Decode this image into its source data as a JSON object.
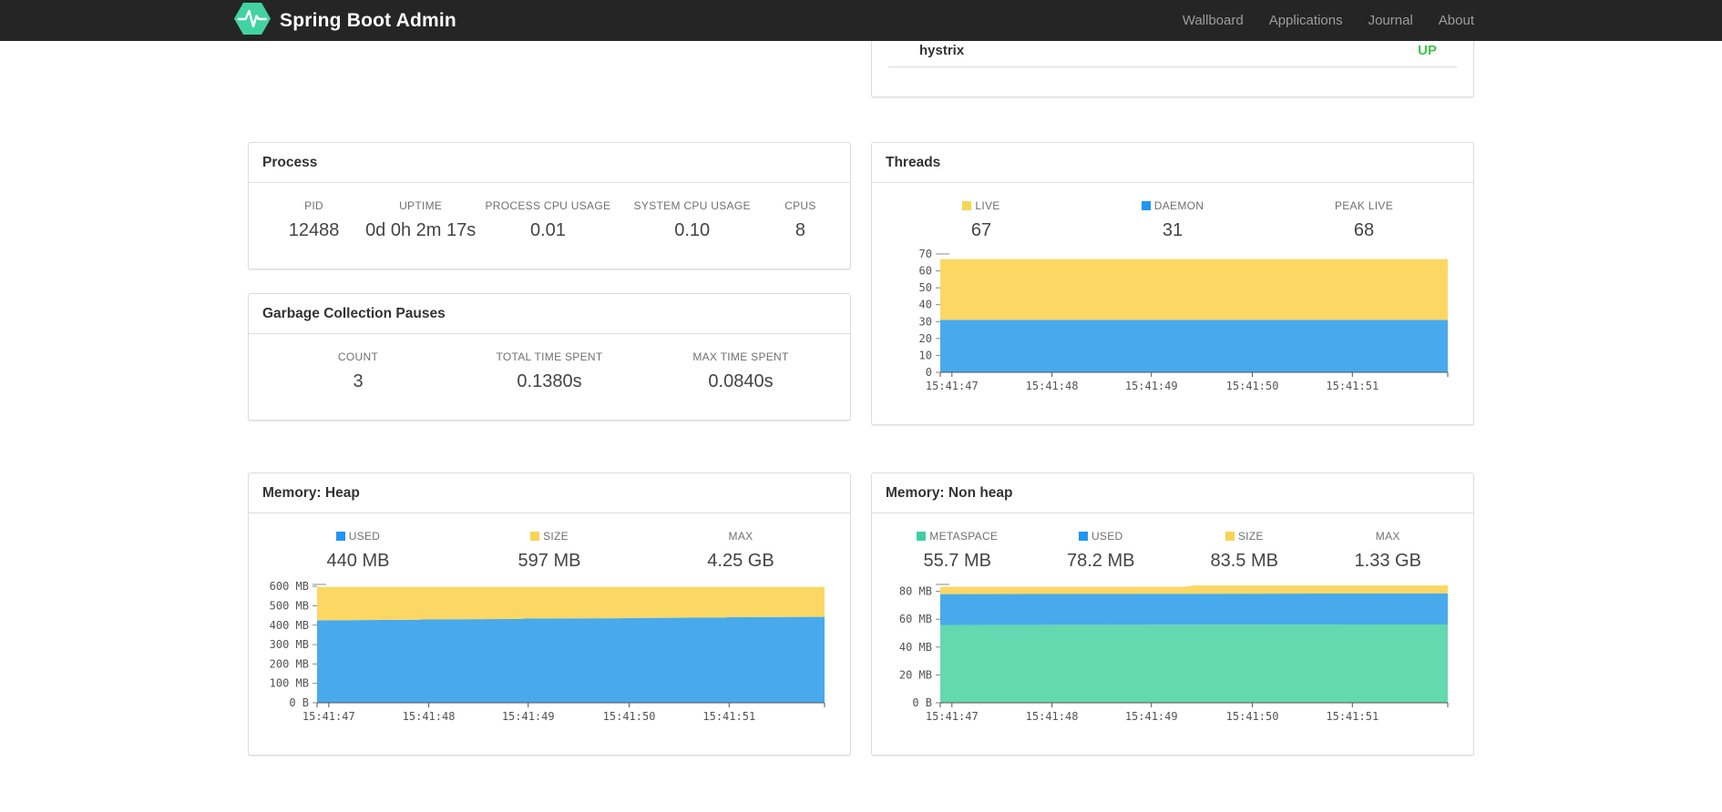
{
  "navbar": {
    "brand": "Spring Boot Admin",
    "links": [
      {
        "label": "Wallboard"
      },
      {
        "label": "Applications"
      },
      {
        "label": "Journal"
      },
      {
        "label": "About"
      }
    ]
  },
  "colors": {
    "navbar_bg": "#252525",
    "brand_green": "#42d3a2",
    "status_up": "#3ec34c",
    "legend_yellow": "#f7d456",
    "legend_blue": "#2196f3",
    "legend_green": "#3fcfa2",
    "area_yellow": "#fbd864",
    "area_blue": "#48aaec",
    "area_green": "#64d8af"
  },
  "health_panel": {
    "rows": [
      {
        "name": "hystrix",
        "status": "UP"
      }
    ]
  },
  "process_panel": {
    "title": "Process",
    "metrics": [
      {
        "label": "PID",
        "value": "12488"
      },
      {
        "label": "UPTIME",
        "value": "0d 0h 2m 17s"
      },
      {
        "label": "PROCESS CPU USAGE",
        "value": "0.01"
      },
      {
        "label": "SYSTEM CPU USAGE",
        "value": "0.10"
      },
      {
        "label": "CPUS",
        "value": "8"
      }
    ]
  },
  "gc_panel": {
    "title": "Garbage Collection Pauses",
    "metrics": [
      {
        "label": "COUNT",
        "value": "3"
      },
      {
        "label": "TOTAL TIME SPENT",
        "value": "0.1380s"
      },
      {
        "label": "MAX TIME SPENT",
        "value": "0.0840s"
      }
    ]
  },
  "threads_panel": {
    "title": "Threads",
    "metrics": [
      {
        "label": "LIVE",
        "value": "67",
        "swatch": "#f7d456"
      },
      {
        "label": "DAEMON",
        "value": "31",
        "swatch": "#2196f3"
      },
      {
        "label": "PEAK LIVE",
        "value": "68"
      }
    ],
    "chart_data": {
      "type": "area",
      "stacked": true,
      "x_tick_labels": [
        "15:41:47",
        "15:41:48",
        "15:41:49",
        "15:41:50",
        "15:41:51"
      ],
      "x_tick_fracs": [
        0.023,
        0.22,
        0.416,
        0.615,
        0.812
      ],
      "ylim": [
        0,
        70
      ],
      "y_ticks": [
        {
          "v": 0,
          "label": "0"
        },
        {
          "v": 10,
          "label": "10"
        },
        {
          "v": 20,
          "label": "20"
        },
        {
          "v": 30,
          "label": "30"
        },
        {
          "v": 40,
          "label": "40"
        },
        {
          "v": 50,
          "label": "50"
        },
        {
          "v": 60,
          "label": "60"
        },
        {
          "v": 70,
          "label": "70"
        }
      ],
      "series": [
        {
          "name": "DAEMON",
          "color": "#48aaec",
          "top": [
            [
              0,
              31
            ],
            [
              1,
              31
            ]
          ]
        },
        {
          "name": "LIVE",
          "color": "#fbd864",
          "top": [
            [
              0,
              67
            ],
            [
              1,
              67
            ]
          ]
        }
      ]
    }
  },
  "heap_panel": {
    "title": "Memory: Heap",
    "metrics": [
      {
        "label": "USED",
        "value": "440 MB",
        "swatch": "#2196f3"
      },
      {
        "label": "SIZE",
        "value": "597 MB",
        "swatch": "#f7d456"
      },
      {
        "label": "MAX",
        "value": "4.25 GB"
      }
    ],
    "chart_data": {
      "type": "area",
      "stacked": true,
      "x_tick_labels": [
        "15:41:47",
        "15:41:48",
        "15:41:49",
        "15:41:50",
        "15:41:51"
      ],
      "x_tick_fracs": [
        0.023,
        0.22,
        0.416,
        0.615,
        0.812
      ],
      "ylim": [
        0,
        610
      ],
      "y_ticks": [
        {
          "v": 0,
          "label": "0 B"
        },
        {
          "v": 100,
          "label": "100 MB"
        },
        {
          "v": 200,
          "label": "200 MB"
        },
        {
          "v": 300,
          "label": "300 MB"
        },
        {
          "v": 400,
          "label": "400 MB"
        },
        {
          "v": 500,
          "label": "500 MB"
        },
        {
          "v": 600,
          "label": "600 MB"
        }
      ],
      "series": [
        {
          "name": "USED",
          "color": "#48aaec",
          "top": [
            [
              0,
              425
            ],
            [
              0.2,
              428
            ],
            [
              0.21,
              430
            ],
            [
              0.4,
              432
            ],
            [
              0.41,
              434
            ],
            [
              0.6,
              436
            ],
            [
              0.61,
              437
            ],
            [
              0.8,
              439
            ],
            [
              0.81,
              441
            ],
            [
              1,
              443
            ]
          ]
        },
        {
          "name": "SIZE",
          "color": "#fbd864",
          "top": [
            [
              0,
              597
            ],
            [
              1,
              597
            ]
          ]
        }
      ]
    }
  },
  "nonheap_panel": {
    "title": "Memory: Non heap",
    "metrics": [
      {
        "label": "METASPACE",
        "value": "55.7 MB",
        "swatch": "#3fcfa2"
      },
      {
        "label": "USED",
        "value": "78.2 MB",
        "swatch": "#2196f3"
      },
      {
        "label": "SIZE",
        "value": "83.5 MB",
        "swatch": "#f7d456"
      },
      {
        "label": "MAX",
        "value": "1.33 GB"
      }
    ],
    "chart_data": {
      "type": "area",
      "stacked": true,
      "x_tick_labels": [
        "15:41:47",
        "15:41:48",
        "15:41:49",
        "15:41:50",
        "15:41:51"
      ],
      "x_tick_fracs": [
        0.023,
        0.22,
        0.416,
        0.615,
        0.812
      ],
      "ylim": [
        0,
        85
      ],
      "y_ticks": [
        {
          "v": 0,
          "label": "0 B"
        },
        {
          "v": 20,
          "label": "20 MB"
        },
        {
          "v": 40,
          "label": "40 MB"
        },
        {
          "v": 60,
          "label": "60 MB"
        },
        {
          "v": 80,
          "label": "80 MB"
        }
      ],
      "series": [
        {
          "name": "METASPACE",
          "color": "#64d8af",
          "top": [
            [
              0,
              55.9
            ],
            [
              1,
              56.2
            ]
          ]
        },
        {
          "name": "USED",
          "color": "#48aaec",
          "top": [
            [
              0,
              78.1
            ],
            [
              0.5,
              78.3
            ],
            [
              1,
              78.6
            ]
          ]
        },
        {
          "name": "SIZE",
          "color": "#fbd864",
          "top": [
            [
              0,
              83.3
            ],
            [
              0.48,
              83.3
            ],
            [
              0.5,
              84.3
            ],
            [
              1,
              84.3
            ]
          ]
        }
      ]
    }
  }
}
